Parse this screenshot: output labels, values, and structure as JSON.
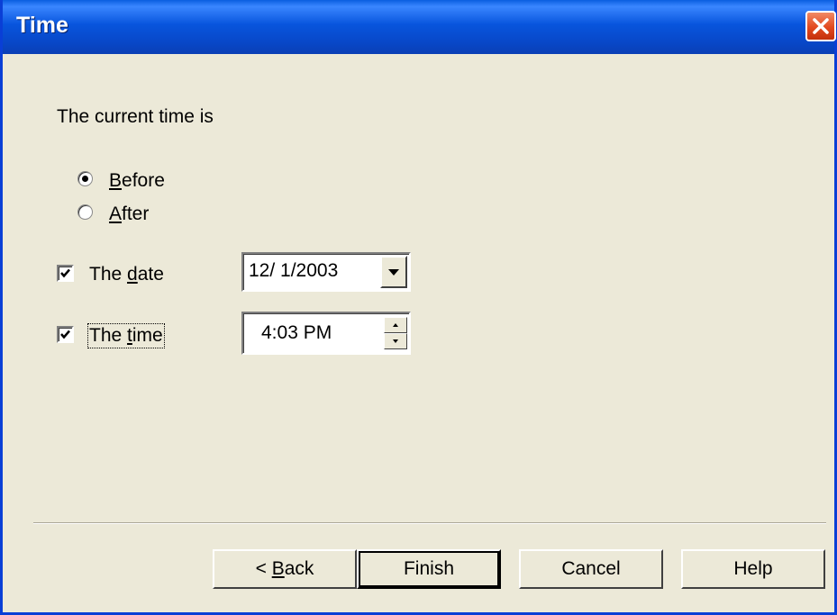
{
  "window": {
    "title": "Time"
  },
  "content": {
    "prompt": "The current time is",
    "radios": [
      {
        "label": "Before",
        "selected": true
      },
      {
        "label": "After",
        "selected": false
      }
    ],
    "date": {
      "label": "The date",
      "checked": true,
      "value": "12/  1/2003"
    },
    "time": {
      "label": "The time",
      "checked": true,
      "value": "4:03 PM"
    }
  },
  "buttons": {
    "back": "< Back",
    "finish": "Finish",
    "cancel": "Cancel",
    "help": "Help"
  },
  "colors": {
    "titlebar": "#0855dd",
    "dialog_bg": "#ece9d8",
    "close": "#e2491f"
  },
  "icons": {
    "close": "close-icon",
    "dropdown": "chevron-down-icon",
    "spin_up": "spin-up-icon",
    "spin_down": "spin-down-icon"
  }
}
